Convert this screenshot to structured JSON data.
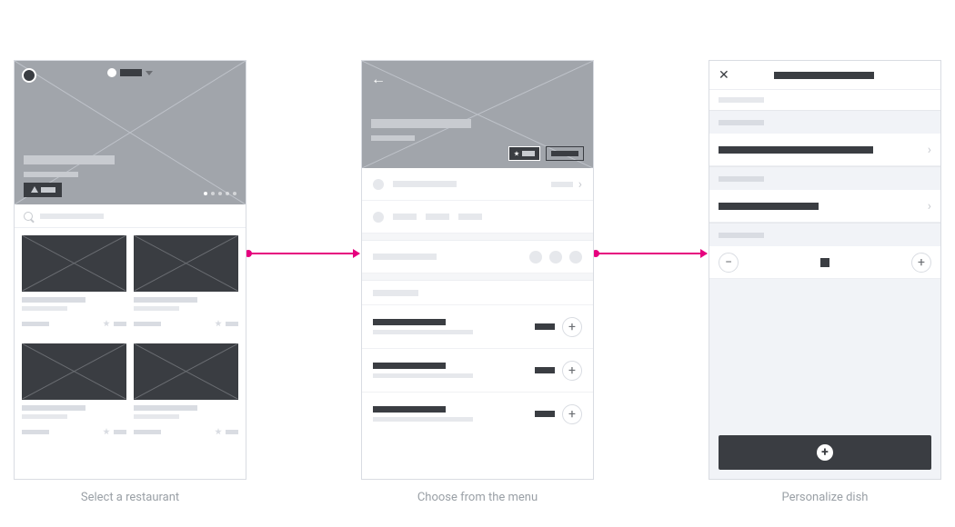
{
  "captions": {
    "screen1": "Select a restaurant",
    "screen2": "Choose from the menu",
    "screen3": "Personalize dish"
  },
  "screen1": {
    "hero_dots_total": 5,
    "hero_dots_active_index": 0,
    "cards_count": 4
  },
  "screen2": {
    "menu_items_count": 3
  },
  "screen3": {
    "options_count": 2
  }
}
